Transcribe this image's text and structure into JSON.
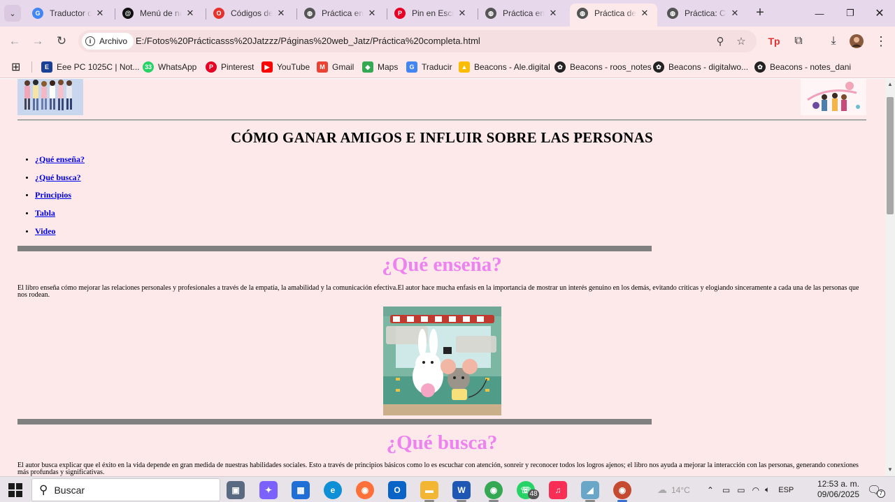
{
  "browser": {
    "tabs": [
      {
        "title": "Traductor de",
        "icon": "google-translate-icon",
        "color": "#4285f4",
        "glyph": "G"
      },
      {
        "title": "Menú de na",
        "icon": "threads-icon",
        "color": "#111111",
        "glyph": "@"
      },
      {
        "title": "Códigos de C",
        "icon": "opera-icon",
        "color": "#e5322d",
        "glyph": "O"
      },
      {
        "title": "Práctica en H",
        "icon": "chrome-page-icon",
        "color": "#555555",
        "glyph": "◍"
      },
      {
        "title": "Pin en Escrit",
        "icon": "pinterest-icon",
        "color": "#e60023",
        "glyph": "P"
      },
      {
        "title": "Práctica en H",
        "icon": "chrome-page-icon",
        "color": "#555555",
        "glyph": "◍"
      },
      {
        "title": "Práctica del I",
        "icon": "chrome-page-icon",
        "color": "#555555",
        "glyph": "◍",
        "active": true
      },
      {
        "title": "Práctica: Cón",
        "icon": "chrome-page-icon",
        "color": "#555555",
        "glyph": "◍"
      }
    ],
    "address": {
      "chip_label": "Archivo",
      "url": "E:/Fotos%20Prácticasss%20Jatzzz/Páginas%20web_Jatz/Práctica%20completa.html"
    },
    "bookmarks": [
      {
        "label": "Eee PC 1025C | Not...",
        "icon": "asus-icon",
        "color": "#1a3f96",
        "glyph": "E"
      },
      {
        "label": "WhatsApp",
        "icon": "whatsapp-icon",
        "color": "#25d366",
        "glyph": "33"
      },
      {
        "label": "Pinterest",
        "icon": "pinterest-icon",
        "color": "#e60023",
        "glyph": "P"
      },
      {
        "label": "YouTube",
        "icon": "youtube-icon",
        "color": "#ff0000",
        "glyph": "▶"
      },
      {
        "label": "Gmail",
        "icon": "gmail-icon",
        "color": "#ea4335",
        "glyph": "M"
      },
      {
        "label": "Maps",
        "icon": "maps-icon",
        "color": "#34a853",
        "glyph": "◆"
      },
      {
        "label": "Traducir",
        "icon": "translate-icon",
        "color": "#4285f4",
        "glyph": "G"
      },
      {
        "label": "Beacons - Ale.digital",
        "icon": "google-drive-icon",
        "color": "#fbbc04",
        "glyph": "▲"
      },
      {
        "label": "Beacons - roos_notes",
        "icon": "beacons-icon",
        "color": "#222222",
        "glyph": "✿"
      },
      {
        "label": "Beacons - digitalwo...",
        "icon": "beacons-icon",
        "color": "#222222",
        "glyph": "✿"
      },
      {
        "label": "Beacons - notes_dani",
        "icon": "beacons-icon",
        "color": "#222222",
        "glyph": "✿"
      }
    ]
  },
  "page": {
    "title": "CÓMO GANAR AMIGOS E INFLUIR SOBRE LAS PERSONAS",
    "nav": [
      "¿Qué enseña?",
      "¿Qué busca?",
      "Principios",
      "Tabla",
      "Video"
    ],
    "sections": [
      {
        "heading": "¿Qué enseña?",
        "text": "El libro enseña cómo mejorar las relaciones personales y profesionales a través de la empatía, la amabilidad y la comunicación efectiva.El autor hace mucha enfasis en la importancia de mostrar un interés genuino en los demás, evitando críticas y elogiando sinceramente a cada una de las personas que nos rodean."
      },
      {
        "heading": "¿Qué busca?",
        "text": "El autor busca explicar que el éxito en la vida depende en gran medida de nuestras habilidades sociales. Esto a través de principios básicos como lo es escuchar con atención, sonreir y reconocer todos los logros ajenos; el libro nos ayuda a mejorar la interacción con las personas, generando conexiones más profundas y significativas."
      }
    ],
    "colors": {
      "background": "#fde9ea",
      "heading": "#ee82ee",
      "link": "#0000ee",
      "rule": "#808080"
    }
  },
  "taskbar": {
    "search_placeholder": "Buscar",
    "apps": [
      {
        "name": "task-view-icon",
        "color": "#5a6a80",
        "glyph": "▣"
      },
      {
        "name": "copilot-icon",
        "color": "#7b61ff",
        "glyph": "✦"
      },
      {
        "name": "store-icon",
        "color": "#1f6fd6",
        "glyph": "▦"
      },
      {
        "name": "edge-icon",
        "color": "#0f8fd6",
        "glyph": "e"
      },
      {
        "name": "firefox-icon",
        "color": "#ff7139",
        "glyph": "◉"
      },
      {
        "name": "outlook-icon",
        "color": "#0a64c8",
        "glyph": "O"
      },
      {
        "name": "file-explorer-icon",
        "color": "#f2b632",
        "glyph": "▬"
      },
      {
        "name": "word-icon",
        "color": "#1f57b4",
        "glyph": "W"
      },
      {
        "name": "chrome-icon",
        "color": "#34a853",
        "glyph": "◉"
      },
      {
        "name": "whatsapp-icon",
        "color": "#25d366",
        "glyph": "☏"
      },
      {
        "name": "itunes-icon",
        "color": "#fa2d55",
        "glyph": "♫"
      },
      {
        "name": "app-icon",
        "color": "#6aa6c8",
        "glyph": "◢"
      },
      {
        "name": "chrome-profile-icon",
        "color": "#c64a30",
        "glyph": "◉"
      }
    ],
    "whatsapp_badge": "48",
    "weather": "14°C",
    "lang": "ESP",
    "time": "12:53 a. m.",
    "date": "09/06/2025",
    "notification_count": "7"
  }
}
